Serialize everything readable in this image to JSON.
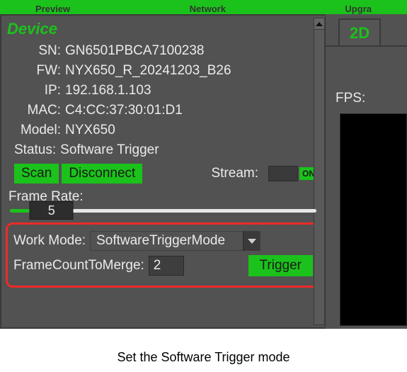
{
  "topbar": {
    "tab1": "Preview",
    "tab2": "Network",
    "tab3": "Upgra"
  },
  "device": {
    "title": "Device",
    "sn_label": "SN:",
    "sn": "GN6501PBCA7100238",
    "fw_label": "FW:",
    "fw": "NYX650_R_20241203_B26",
    "ip_label": "IP:",
    "ip": "192.168.1.103",
    "mac_label": "MAC:",
    "mac": "C4:CC:37:30:01:D1",
    "model_label": "Model:",
    "model": "NYX650",
    "status_label": "Status:",
    "status": "Software Trigger",
    "scan_btn": "Scan",
    "disconnect_btn": "Disconnect",
    "stream_label": "Stream:",
    "stream_toggle": "ON",
    "framerate_label": "Frame Rate:",
    "framerate_value": "5",
    "workmode_label": "Work Mode:",
    "workmode_value": "SoftwareTriggerMode",
    "fctm_label": "FrameCountToMerge:",
    "fctm_value": "2",
    "trigger_btn": "Trigger"
  },
  "right": {
    "tab2d": "2D",
    "fps_label": "FPS:"
  },
  "caption": "Set the Software Trigger mode"
}
